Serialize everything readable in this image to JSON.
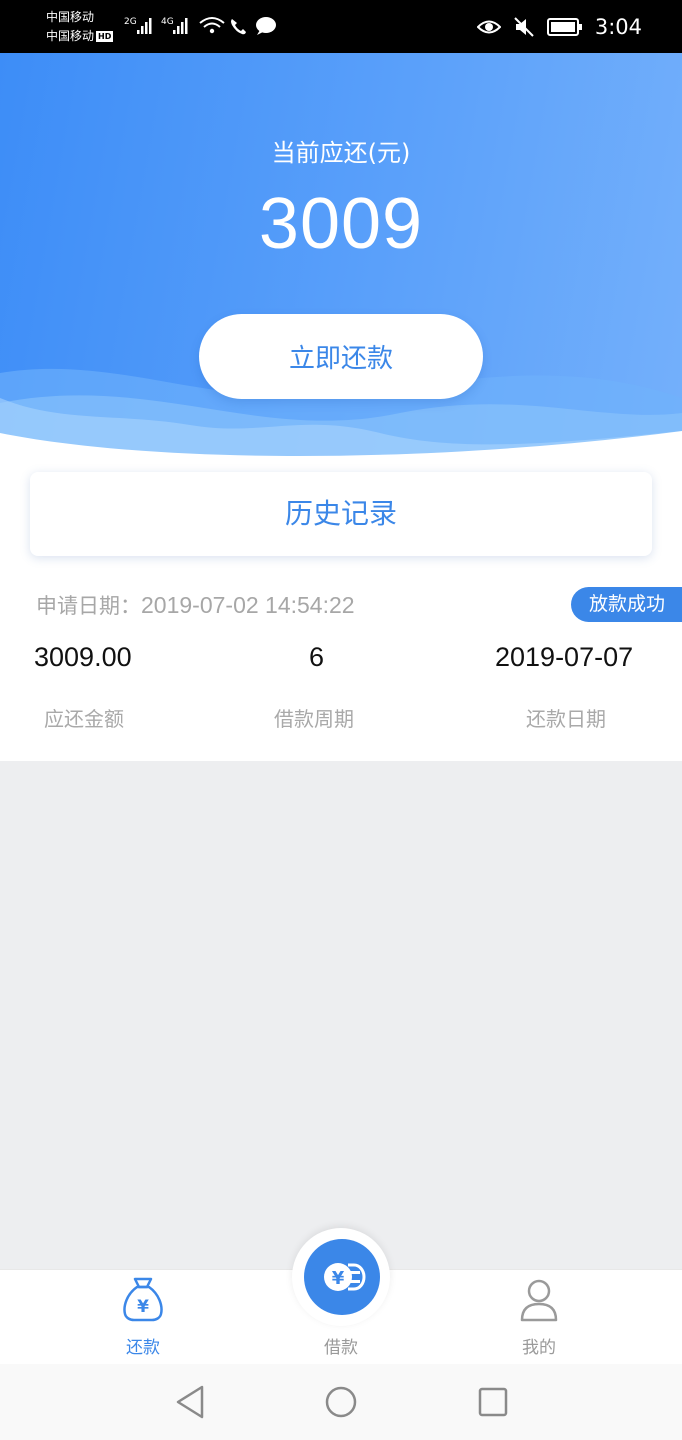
{
  "status_bar": {
    "carrier_1": "中国移动",
    "carrier_2": "中国移动",
    "hd_badge": "HD",
    "net_1": "2G",
    "net_2": "4G",
    "time": "3:04"
  },
  "header": {
    "due_label": "当前应还(元)",
    "due_amount": "3009",
    "repay_button": "立即还款"
  },
  "history_button": "历史记录",
  "record": {
    "apply_label": "申请日期：",
    "apply_value": "2019-07-02 14:54:22",
    "status": "放款成功",
    "amount_value": "3009.00",
    "amount_label": "应还金额",
    "period_value": "6",
    "period_label": "借款周期",
    "due_date_value": "2019-07-07",
    "due_date_label": "还款日期"
  },
  "tabs": [
    {
      "label": "还款",
      "icon": "money-bag-icon",
      "active": true
    },
    {
      "label": "借款",
      "icon": "yen-coin-icon",
      "active": false
    },
    {
      "label": "我的",
      "icon": "user-icon",
      "active": false
    }
  ],
  "colors": {
    "accent": "#3b87e8",
    "header_start": "#3d8df7",
    "header_end": "#74b0fb",
    "inactive_tab": "#9a9a9a"
  }
}
